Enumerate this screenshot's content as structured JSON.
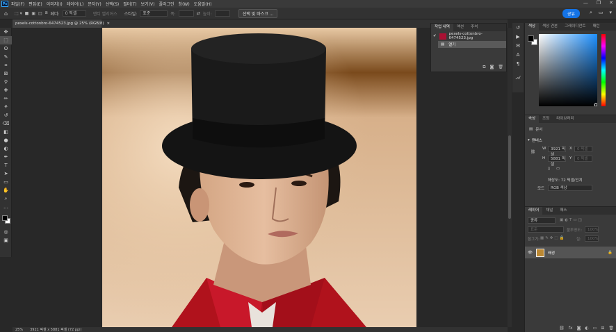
{
  "menu": {
    "app_icon": "Ps",
    "items": [
      "파일(F)",
      "편집(E)",
      "이미지(I)",
      "레이어(L)",
      "문자(Y)",
      "선택(S)",
      "필터(T)",
      "보기(V)",
      "플러그인",
      "창(W)",
      "도움말(H)"
    ],
    "window_controls": [
      "—",
      "❐",
      "✕"
    ]
  },
  "options": {
    "feather_label": "페더:",
    "feather_value": "0 픽셀",
    "antialias": "앤티 앨리어스",
    "style_label": "스타일:",
    "style_value": "표준",
    "width_label": "폭:",
    "height_label": "높이:",
    "mask_button": "선택 및 마스크 ...",
    "share_button": "공유"
  },
  "document": {
    "tab_title": "pexels-cottonbro-6474523.jpg @ 25% (RGB/8)",
    "tab_close": "×",
    "zoom": "25%",
    "size_info": "3921 픽셀 x 5881 픽셀 (72 ppi)"
  },
  "history_panel": {
    "tabs": [
      "작업 내역",
      "액션",
      "주석"
    ],
    "snapshot_name": "pexels-cottonbro-6474523.jpg",
    "state_open": "열기"
  },
  "color_panel": {
    "tabs": [
      "색상",
      "색상 견본",
      "그레이디언트",
      "패턴"
    ],
    "foreground": "#000000",
    "background": "#ffffff"
  },
  "properties_panel": {
    "tabs": [
      "속성",
      "조정",
      "라이브러리"
    ],
    "kind": "문서",
    "section": "캔버스",
    "width_label": "W",
    "width_value": "3921 픽셀",
    "height_label": "H",
    "height_value": "5881 픽셀",
    "x_label": "X",
    "y_label": "Y",
    "x_value": "0 픽셀",
    "y_value": "0 픽셀",
    "resolution": "해상도: 72 픽셀/인치",
    "mode_label": "모드",
    "mode_value": "RGB 색상"
  },
  "layers_panel": {
    "tabs": [
      "레이어",
      "채널",
      "패스"
    ],
    "search_placeholder": "종류",
    "blend_mode": "표준",
    "opacity_label": "불투명도:",
    "opacity_value": "100%",
    "lock_label": "잠그기:",
    "fill_label": "칠:",
    "fill_value": "100%",
    "layer_name": "배경"
  }
}
